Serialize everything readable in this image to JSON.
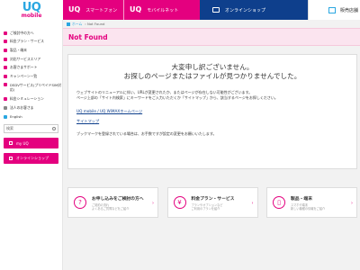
{
  "header": {
    "logo_text": "UQ",
    "logo_sub": "mobile",
    "tabs": [
      {
        "mini": "UQ",
        "label": "スマートフォン"
      },
      {
        "mini": "UQ",
        "label": "モバイルネット"
      },
      {
        "label": "オンラインショップ"
      },
      {
        "label": "販売店舗"
      }
    ]
  },
  "sidebar": {
    "items": [
      "ご検討中の方へ",
      "料金プラン・サービス",
      "製品・端末",
      "対応サービスエリア",
      "お客さまサポート",
      "キャンペーン一覧",
      "DSDVサービス(プリペイドSIM対応)",
      "料金シミュレーション",
      "法人のお客さま",
      "English"
    ],
    "search_placeholder": "検索",
    "buttons": [
      "my UQ",
      "オンラインショップ"
    ]
  },
  "breadcrumb": {
    "home": "ホーム",
    "current": "Not Found"
  },
  "page_title": "Not Found",
  "message": {
    "big_line1": "大変申し訳ございません。",
    "big_line2": "お探しのページまたはファイルが見つかりませんでした。",
    "small_line1": "ウェブサイトのリニューアルに伴い、URLが変更されたか、またはページが存在しない可能性がございます。",
    "small_line2": "ページ上部の「サイト内検索」にキーワードをご入力いただくか「サイトマップ」から、該当するページをお探しください。",
    "link1": "UQ mobile / UQ WiMAXホームページ",
    "link2": "サイトマップ",
    "foot": "ブックマークを登録されている場合は、お手数ですが設定の変更をお願いいたします。"
  },
  "cards": [
    {
      "title": "お申し込みをご検討の方へ",
      "sub": "ご契約の流れ\nよくあるご質問などをご紹介"
    },
    {
      "title": "料金プラン・サービス",
      "sub": "プランやオプションなど\nご利用のプランを紹介"
    },
    {
      "title": "製品・端末",
      "sub": "スマホや端末\n新しい機種の情報をご紹介"
    }
  ],
  "colors": {
    "accent": "#e4007f",
    "brand_blue": "#2aa7e1",
    "navy": "#0e3f8c"
  }
}
